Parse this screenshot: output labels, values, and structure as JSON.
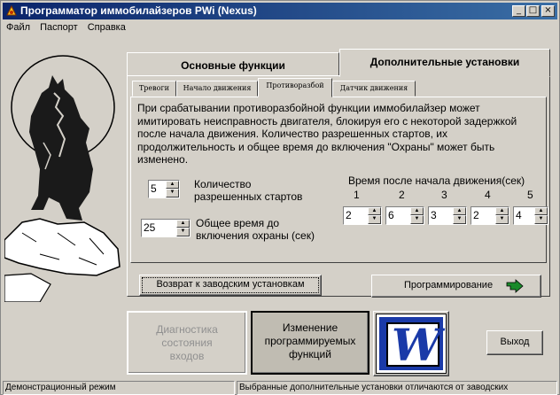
{
  "window": {
    "title": "Программатор иммобилайзеров PWi (Nexus)"
  },
  "titlebar_buttons": [
    "_",
    "□",
    "×"
  ],
  "menu": [
    "Файл",
    "Паспорт",
    "Справка"
  ],
  "main_tabs": [
    "Основные функции",
    "Дополнительные установки"
  ],
  "sub_tabs": [
    "Тревоги",
    "Начало движения",
    "Противоразбой",
    "Датчик движения"
  ],
  "description": "При срабатывании противоразбойной функции иммобилайзер может имитировать неисправность двигателя, блокируя его с некоторой задержкой после начала движения. Количество разрешенных стартов, их продолжительность и общее время до включения \"Охраны\" может быть изменено.",
  "starts": {
    "value": "5",
    "label_line1": "Количество",
    "label_line2": "разрешенных стартов"
  },
  "total_time": {
    "value": "25",
    "label_line1": "Общее время до",
    "label_line2": "включения охраны (сек)"
  },
  "time_after": {
    "title": "Время после начала движения(сек)",
    "columns": [
      "1",
      "2",
      "3",
      "4",
      "5"
    ],
    "values": [
      "2",
      "6",
      "3",
      "2",
      "4"
    ]
  },
  "buttons": {
    "reset": "Возврат к заводским установкам",
    "program": "Программирование",
    "diag_line1": "Диагностика",
    "diag_line2": "состояния",
    "diag_line3": "входов",
    "change_line1": "Изменение",
    "change_line2": "программируемых",
    "change_line3": "функций",
    "exit": "Выход",
    "logo_letter": "W"
  },
  "status": {
    "left": "Демонстрационный режим",
    "right": "Выбранные дополнительные установки отличаются от заводских"
  },
  "colors": {
    "title_bg": "#0a246a",
    "face": "#d4d0c8",
    "program_arrow": "#1a8a2a",
    "logo_blue": "#1a3aa8"
  },
  "icons": [
    "app-icon",
    "wolf-moon-image",
    "program-arrow-icon",
    "w-logo"
  ]
}
